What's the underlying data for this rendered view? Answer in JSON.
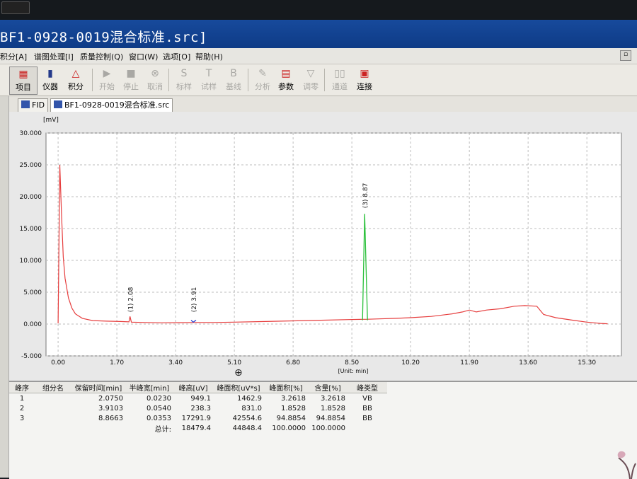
{
  "window": {
    "title": "BF1-0928-0019混合标准.src]"
  },
  "menu": {
    "items": [
      "积分[A]",
      "谱图处理[I]",
      "质量控制(Q)",
      "窗口(W)",
      "选项[O]",
      "帮助(H)"
    ]
  },
  "toolbar": {
    "buttons": [
      {
        "label": "项目",
        "icon": "project-icon",
        "enabled": true
      },
      {
        "label": "仪器",
        "icon": "instrument-icon",
        "enabled": true
      },
      {
        "label": "积分",
        "icon": "integrate-icon",
        "enabled": true
      },
      {
        "label": "开始",
        "icon": "play-icon",
        "enabled": false
      },
      {
        "label": "停止",
        "icon": "stop-icon",
        "enabled": false
      },
      {
        "label": "取消",
        "icon": "cancel-icon",
        "enabled": false
      },
      {
        "label": "标样",
        "icon": "standard-icon",
        "enabled": false
      },
      {
        "label": "试样",
        "icon": "sample-icon",
        "enabled": false
      },
      {
        "label": "基线",
        "icon": "baseline-icon",
        "enabled": false
      },
      {
        "label": "分析",
        "icon": "analysis-icon",
        "enabled": false
      },
      {
        "label": "参数",
        "icon": "params-icon",
        "enabled": true
      },
      {
        "label": "调零",
        "icon": "zero-icon",
        "enabled": false
      },
      {
        "label": "通道",
        "icon": "channel-icon",
        "enabled": false
      },
      {
        "label": "连接",
        "icon": "connect-icon",
        "enabled": true
      }
    ]
  },
  "tabs": [
    {
      "label": "FID"
    },
    {
      "label": "BF1-0928-0019混合标准.src"
    }
  ],
  "chart_data": {
    "type": "line",
    "ylabel": "[mV]",
    "xunit": "[Unit: min]",
    "xlim": [
      -0.35,
      16.3
    ],
    "ylim": [
      -5,
      30
    ],
    "xticks": [
      "0.00",
      "1.70",
      "3.40",
      "5.10",
      "6.80",
      "8.50",
      "10.20",
      "11.90",
      "13.60",
      "15.30"
    ],
    "yticks": [
      "-5.000",
      "0.000",
      "5.000",
      "10.000",
      "15.000",
      "20.000",
      "25.000",
      "30.000"
    ],
    "series": [
      {
        "color": "#e63e3e",
        "x": [
          0.0,
          0.05,
          0.1,
          0.15,
          0.2,
          0.3,
          0.4,
          0.5,
          0.7,
          1.0,
          1.4,
          1.8,
          2.05,
          2.08,
          2.12,
          2.5,
          3.0,
          3.6,
          3.91,
          4.5,
          5.1,
          6.0,
          6.8,
          7.6,
          8.4,
          8.84,
          8.9,
          9.2,
          9.8,
          10.2,
          10.8,
          11.4,
          11.7,
          11.9,
          12.1,
          12.4,
          12.8,
          13.2,
          13.5,
          13.85,
          14.05,
          14.4,
          14.9,
          15.3,
          15.5,
          15.7,
          15.9
        ],
        "y": [
          0.1,
          25.0,
          17.0,
          10.5,
          7.2,
          4.1,
          2.5,
          1.6,
          0.9,
          0.55,
          0.45,
          0.4,
          0.35,
          1.2,
          0.3,
          0.25,
          0.2,
          0.22,
          0.25,
          0.25,
          0.3,
          0.4,
          0.5,
          0.6,
          0.7,
          0.75,
          0.75,
          0.8,
          0.9,
          1.0,
          1.2,
          1.6,
          1.9,
          2.2,
          1.9,
          2.2,
          2.4,
          2.8,
          2.9,
          2.8,
          1.5,
          1.0,
          0.6,
          0.3,
          0.2,
          0.1,
          0.05
        ]
      }
    ],
    "peaks": [
      {
        "label": "(1) 2.08",
        "rt": 2.08,
        "height": 1.2,
        "color": "#e63e3e"
      },
      {
        "label": "(2) 3.91",
        "rt": 3.91,
        "height": 0.3,
        "color": "#2a3fcf"
      },
      {
        "label": "(3) 8.87",
        "rt": 8.87,
        "height": 17.3,
        "color": "#2ac03a"
      }
    ]
  },
  "table": {
    "headers": [
      "峰序",
      "组分名",
      "保留时间[min]",
      "半峰宽[min]",
      "峰高[uV]",
      "峰面积[uV*s]",
      "峰面积[%]",
      "含量[%]",
      "峰类型"
    ],
    "rows": [
      [
        "1",
        "",
        "2.0750",
        "0.0230",
        "949.1",
        "1462.9",
        "3.2618",
        "3.2618",
        "VB"
      ],
      [
        "2",
        "",
        "3.9103",
        "0.0540",
        "238.3",
        "831.0",
        "1.8528",
        "1.8528",
        "BB"
      ],
      [
        "3",
        "",
        "8.8663",
        "0.0353",
        "17291.9",
        "42554.6",
        "94.8854",
        "94.8854",
        "BB"
      ]
    ],
    "total": {
      "label": "总计:",
      "height": "18479.4",
      "area": "44848.4",
      "area_pct": "100.0000",
      "content_pct": "100.0000"
    }
  }
}
